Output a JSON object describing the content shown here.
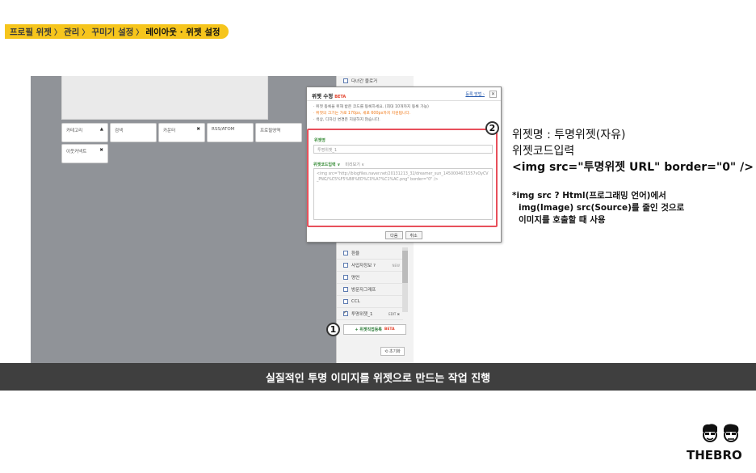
{
  "breadcrumb": {
    "items": [
      "프로필 위젯",
      "관리",
      "꾸미기 설정"
    ],
    "current": "레이아웃 · 위젯 설정",
    "separator": "〉"
  },
  "screenshot": {
    "widgets": [
      {
        "label": "카테고리",
        "mark": "▲"
      },
      {
        "label": "검색",
        "mark": ""
      },
      {
        "label": "카운터",
        "mark": "✖"
      },
      {
        "label": "RSS/ATOM",
        "mark": ""
      },
      {
        "label": "프로필영역",
        "mark": ""
      },
      {
        "label": "이웃커넥트",
        "mark": "✖"
      }
    ],
    "right_panel": {
      "top_item": "다녀간 블로거",
      "items": [
        {
          "label": "환율",
          "checked": false,
          "extra": ""
        },
        {
          "label": "사업자정보 ?",
          "checked": false,
          "extra": "NEW"
        },
        {
          "label": "명언",
          "checked": false,
          "extra": ""
        },
        {
          "label": "방문자그래프",
          "checked": false,
          "extra": ""
        },
        {
          "label": "CCL",
          "checked": false,
          "extra": ""
        },
        {
          "label": "투명위젯_1",
          "checked": true,
          "extra": "EDIT ✖"
        }
      ],
      "add_button": "+ 위젯직접등록",
      "add_button_badge": "BETA",
      "reset_button": "⟲ 초기화"
    }
  },
  "dialog": {
    "title": "위젯 수정",
    "badge": "BETA",
    "help": "등록 방법 ›",
    "close": "✕",
    "notes": [
      "· 위젯 등록을 위해 받은 코드를 등록하세요. (최대 10개까지 등록 가능)",
      "· 위젯의 크기는 가로 170px, 세로 600px까지 지원됩니다.",
      "· 색상, 디자인 변경은 지원하지 않습니다."
    ],
    "name_label": "위젯명",
    "name_value": "투명위젯_1",
    "code_tab_active": "위젯코드입력 ∨",
    "code_tab_inactive": "미리보기 ∨",
    "code_value": "<img src=\"http://blogfiles.naver.net/20131213_32/dreamer_sun_1450004671557vOyCV_PNG/%C5%F5%B8%ED%C0%A7%C1%AC.png\" border=\"0\" />",
    "next_button": "다음",
    "cancel_button": "취소"
  },
  "markers": {
    "one": "1",
    "two": "2"
  },
  "annotation": {
    "line1": "위젯명 : 투명위젯(자유)",
    "line2": "위젯코드입력",
    "line3": "<img src=\"투명위젯 URL\" border=\"0\" />",
    "note1": "*img src ? Html(프로그래밍 언어)에서",
    "note2": "img(Image) src(Source)를 줄인 것으로",
    "note3": "이미지를 호출할 때 사용"
  },
  "caption": "실질적인 투명 이미지를 위젯으로 만드는 작업 진행",
  "logo": {
    "text": "THEBRO"
  },
  "colors": {
    "accent_yellow": "#f6c51c",
    "highlight_red": "#e8505b",
    "caption_bg": "#3f3f3f"
  }
}
